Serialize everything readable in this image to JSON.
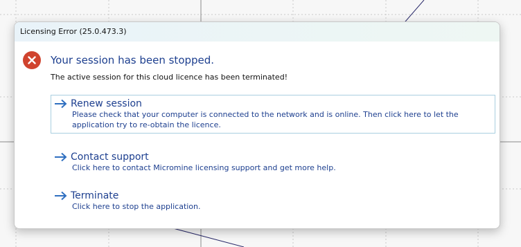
{
  "window": {
    "title": "Licensing Error (25.0.473.3)"
  },
  "header": {
    "icon": "error-icon",
    "title": "Your session has been stopped."
  },
  "message": "The active session for this cloud licence has been terminated!",
  "options": [
    {
      "icon": "arrow-right-icon",
      "label": "Renew session",
      "description": "Please check that your computer is connected to the network and is online. Then click here to let the application try to re-obtain the licence.",
      "selected": true
    },
    {
      "icon": "arrow-right-icon",
      "label": "Contact support",
      "description": "Click here to contact Micromine licensing support and get more help.",
      "selected": false
    },
    {
      "icon": "arrow-right-icon",
      "label": "Terminate",
      "description": "Click here to stop the application.",
      "selected": false
    }
  ],
  "colors": {
    "accent": "#1d3f8f",
    "error": "#d0432e",
    "selection_border": "#a9cfe0"
  }
}
